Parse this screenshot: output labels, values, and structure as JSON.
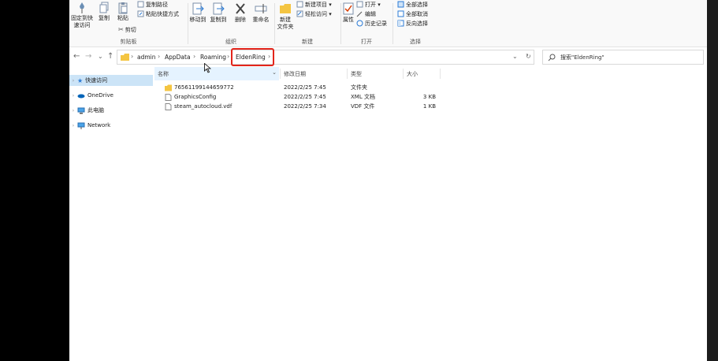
{
  "ribbon": {
    "clipboard": {
      "pin_label_1": "固定到快",
      "pin_label_2": "速访问",
      "copy_label": "复制",
      "paste_label": "粘贴",
      "copy_path_label": "复制路径",
      "paste_shortcut_label": "粘贴快捷方式",
      "cut_label": "剪切",
      "group_label": "剪贴板"
    },
    "organize": {
      "move_to_label": "移动到",
      "copy_to_label": "复制到",
      "delete_label": "删除",
      "rename_label": "重命名",
      "group_label": "组织"
    },
    "new": {
      "new_folder_label_1": "新建",
      "new_folder_label_2": "文件夹",
      "new_item_label": "新建项目 ▾",
      "easy_access_label": "轻松访问 ▾",
      "group_label": "新建"
    },
    "open": {
      "properties_label": "属性",
      "open_label": "打开 ▾",
      "edit_label": "编辑",
      "history_label": "历史记录",
      "group_label": "打开"
    },
    "select": {
      "select_all_label": "全部选择",
      "select_none_label": "全部取消",
      "invert_label": "反向选择",
      "group_label": "选择"
    }
  },
  "nav": {
    "back": "←",
    "forward": "→",
    "recent": "⌄",
    "up": "↑",
    "breadcrumbs": [
      "admin",
      "AppData",
      "Roaming",
      "EldenRing"
    ],
    "sep": "›",
    "dropdown": "⌄",
    "refresh": "↻",
    "search_placeholder": "搜索\"EldenRing\""
  },
  "sidebar": {
    "items": [
      {
        "label": "快速访问",
        "icon": "star-icon"
      },
      {
        "label": "OneDrive",
        "icon": "cloud-icon"
      },
      {
        "label": "此电脑",
        "icon": "computer-icon"
      },
      {
        "label": "Network",
        "icon": "network-icon"
      }
    ],
    "chevron": "›"
  },
  "columns": {
    "name": "名称",
    "date": "修改日期",
    "type": "类型",
    "size": "大小"
  },
  "files": [
    {
      "name": "76561199144659772",
      "date": "2022/2/25 7:45",
      "type": "文件夹",
      "size": "",
      "icon": "folder-icon"
    },
    {
      "name": "GraphicsConfig",
      "date": "2022/2/25 7:45",
      "type": "XML 文档",
      "size": "3 KB",
      "icon": "file-icon"
    },
    {
      "name": "steam_autocloud.vdf",
      "date": "2022/2/25 7:34",
      "type": "VDF 文件",
      "size": "1 KB",
      "icon": "file-icon"
    }
  ],
  "colors": {
    "accent": "#0078d4",
    "folder": "#f4c542",
    "highlight": "#e3251b",
    "selected": "#cce4f7"
  }
}
